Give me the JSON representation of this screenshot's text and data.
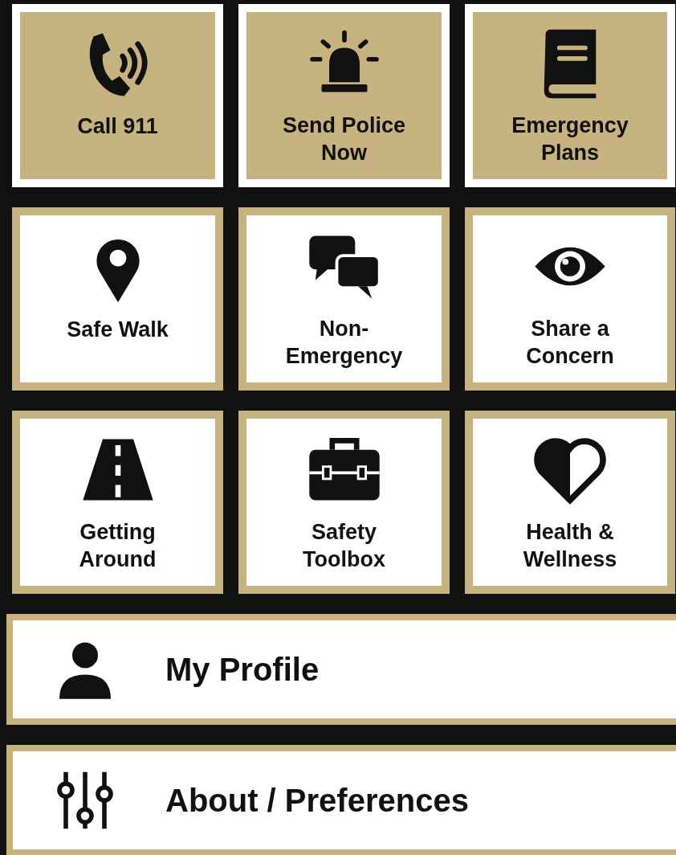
{
  "tiles": [
    {
      "label": "Call 911",
      "kind": "emergency"
    },
    {
      "label": "Send Police Now",
      "kind": "emergency"
    },
    {
      "label": "Emergency Plans",
      "kind": "emergency"
    },
    {
      "label": "Safe Walk",
      "kind": "standard"
    },
    {
      "label": "Non-Emergency",
      "kind": "standard"
    },
    {
      "label": "Share a Concern",
      "kind": "standard"
    },
    {
      "label": "Getting Around",
      "kind": "standard"
    },
    {
      "label": "Safety Toolbox",
      "kind": "standard"
    },
    {
      "label": "Health & Wellness",
      "kind": "standard"
    }
  ],
  "menu": [
    {
      "label": "My Profile"
    },
    {
      "label": "About / Preferences"
    }
  ]
}
